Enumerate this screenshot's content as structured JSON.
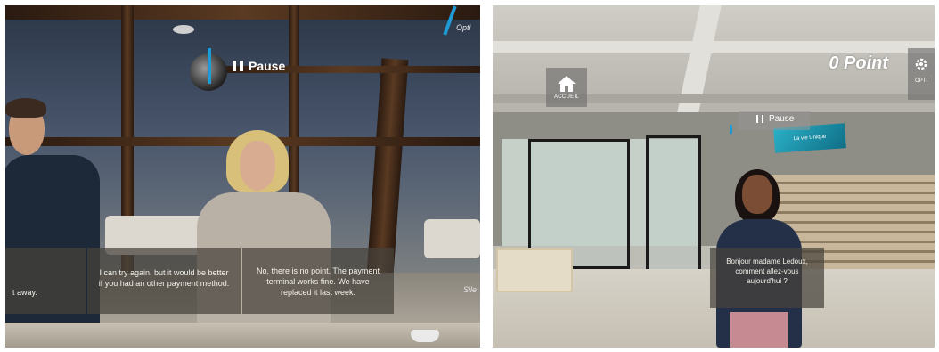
{
  "left_scene": {
    "pause_label": "Pause",
    "options_label": "Opti",
    "silent_label": "Sile",
    "subtitle_left_fragment": "t away.",
    "subtitle_middle": "I can try again, but it would be better if you had an other payment method.",
    "subtitle_right": "No, there is no point. The payment terminal works fine. We have replaced it last week."
  },
  "right_scene": {
    "home_label": "ACCUEIL",
    "points_label": "0 Point",
    "options_label": "OPTI",
    "pause_label": "Pause",
    "screen_text": "La vie Unique",
    "subtitle": "Bonjour madame Ledoux, comment allez-vous aujourd'hui ?"
  },
  "colors": {
    "accent": "#1e9ad6",
    "hud_text": "#ffffff"
  },
  "icons": {
    "pause": "pause-icon",
    "home": "home-icon",
    "gear": "gear-icon"
  }
}
